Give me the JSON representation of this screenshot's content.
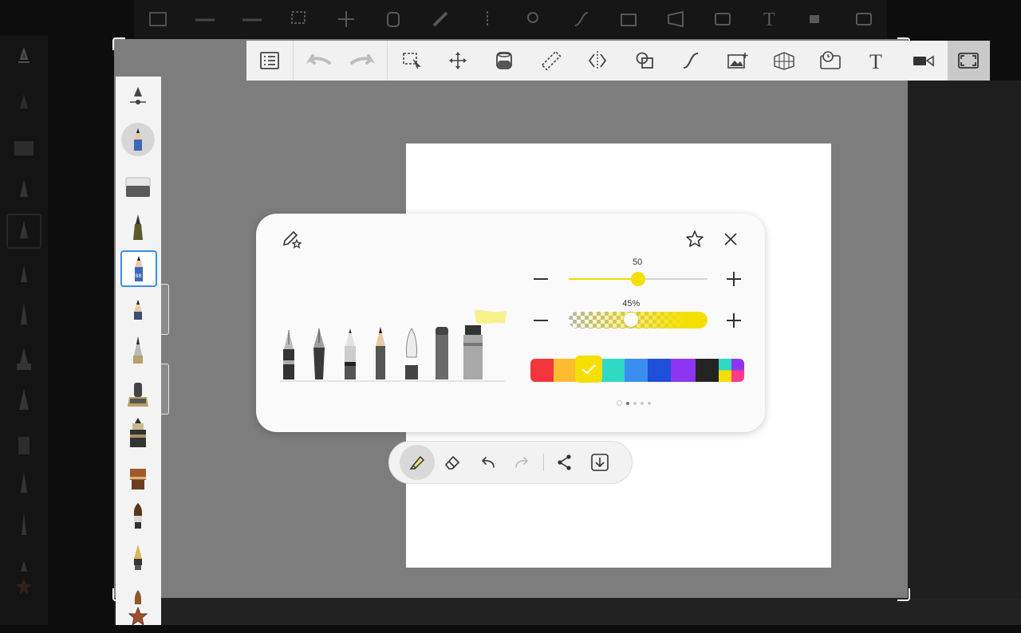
{
  "brush_settings": {
    "size_value": "50",
    "size_fraction": 0.5,
    "opacity_value": "45%",
    "opacity_fraction": 0.45,
    "accent_color": "#f4df00",
    "palette": [
      "#f3343a",
      "#fdbb30",
      "#f4df00",
      "#2fd9c3",
      "#3a8ef0",
      "#1d4fd8",
      "#8d35f2",
      "#232323",
      "multicolor"
    ],
    "selected_palette_index": 2,
    "page_indicator": {
      "count": 5,
      "active_index": 1
    },
    "pen_tips": [
      "fountain-pen-tip-icon",
      "calligraphy-pen-tip-icon",
      "ballpoint-pen-tip-icon",
      "pencil-tip-icon",
      "brush-pen-tip-icon",
      "marker-tip-icon",
      "highlighter-tip-icon"
    ]
  },
  "top_toolbar_icons": [
    "list-icon",
    "undo-icon",
    "redo-icon",
    "selection-icon",
    "transform-icon",
    "fill-icon",
    "ruler-icon",
    "symmetry-icon",
    "shape-icon",
    "curve-icon",
    "add-image-icon",
    "perspective-icon",
    "time-lapse-icon",
    "text-icon",
    "video-icon",
    "fullscreen-icon"
  ],
  "text_tool_glyph": "T",
  "mini_toolbar_icons": [
    "highlighter-icon",
    "eraser-icon",
    "undo-icon",
    "redo-icon",
    "share-icon",
    "save-icon"
  ],
  "pencil_badge": "BB"
}
